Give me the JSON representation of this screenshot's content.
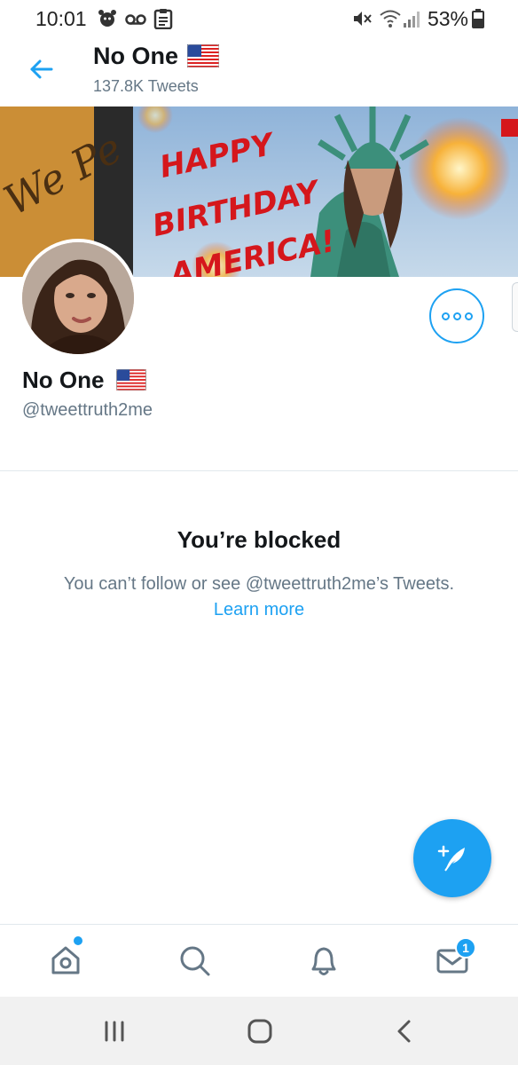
{
  "status_bar": {
    "time": "10:01",
    "battery_percent": "53%"
  },
  "header": {
    "title": "No One",
    "tweet_count": "137.8K Tweets"
  },
  "banner": {
    "text_line1": "HAPPY",
    "text_line2": "BIRTHDAY",
    "text_line3": "AMERICA!"
  },
  "profile": {
    "name": "No One",
    "handle": "@tweettruth2me"
  },
  "blocked": {
    "title": "You’re blocked",
    "message": "You can’t follow or see @tweettruth2me’s Tweets.",
    "learn_more": "Learn more"
  },
  "bottom_nav": {
    "items": [
      "home-icon",
      "search-icon",
      "notifications-icon",
      "messages-icon"
    ],
    "messages_badge": "1"
  },
  "colors": {
    "accent": "#1da1f2",
    "text_primary": "#14171a",
    "text_secondary": "#657786"
  }
}
